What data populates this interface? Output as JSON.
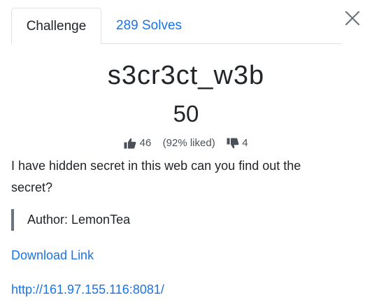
{
  "tabs": {
    "challenge_label": "Challenge",
    "solves_label": "289 Solves"
  },
  "challenge": {
    "title": "s3cr3ct_w3b",
    "points": "50",
    "likes": "46",
    "liked_percent": "(92% liked)",
    "dislikes": "4",
    "description": "I have hidden secret in this web can you find out the secret?",
    "author": "Author: LemonTea",
    "download_link": "Download Link",
    "url": "http://161.97.155.116:8081/"
  },
  "icons": {
    "close": "close-icon",
    "thumbs_up": "thumbs-up-icon",
    "thumbs_down": "thumbs-down-icon"
  },
  "colors": {
    "link": "#1a73e8",
    "text": "#212529",
    "quote_bar": "#6c757d"
  }
}
